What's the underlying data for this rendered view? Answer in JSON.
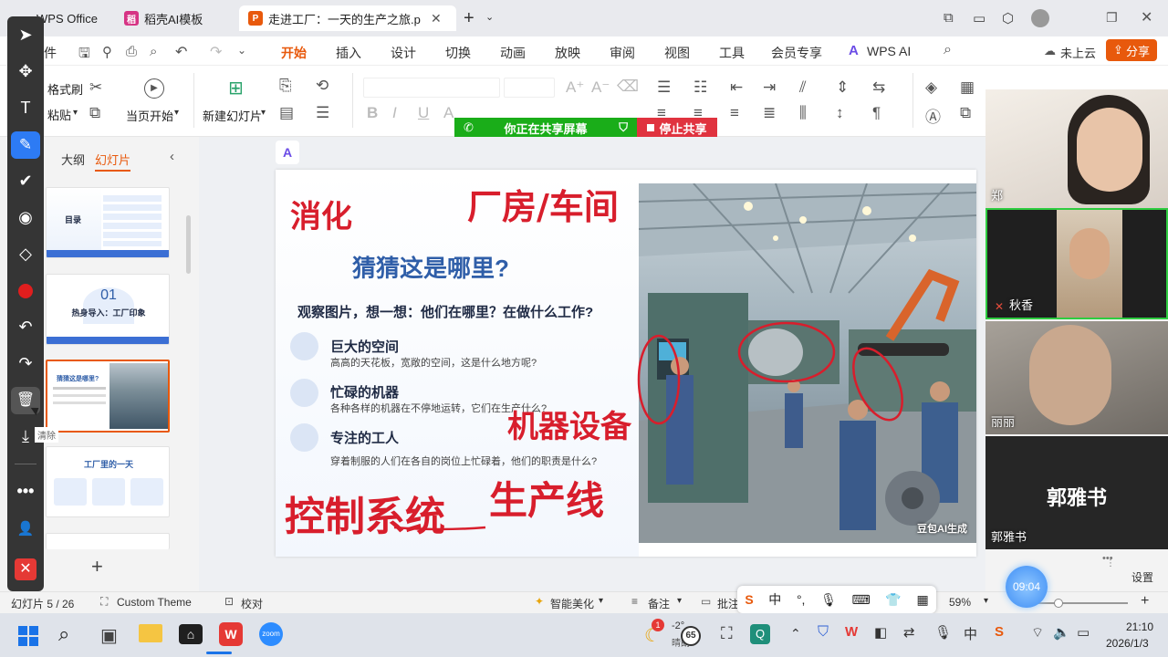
{
  "tabs": [
    {
      "label": "WPS Office"
    },
    {
      "label": "稻壳AI模板"
    },
    {
      "label": "走进工厂：一天的生产之旅.p"
    }
  ],
  "menu": {
    "file": "件",
    "items": [
      "开始",
      "插入",
      "设计",
      "切换",
      "动画",
      "放映",
      "审阅",
      "视图",
      "工具",
      "会员专享"
    ],
    "wps_ai": "WPS AI",
    "cloud": "未上云",
    "share": "分享"
  },
  "ribbon": {
    "format_painter": "格式刷",
    "paste": "粘贴",
    "play_from_current": "当页开始",
    "new_slide": "新建幻灯片"
  },
  "screen_share": {
    "status": "你正在共享屏幕",
    "stop": "停止共享"
  },
  "panel": {
    "outline_tab": "大纲",
    "slides_tab": "幻灯片"
  },
  "thumbnails": [
    {
      "title": "目录",
      "kind": "toc"
    },
    {
      "number": "01",
      "title": "热身导入：工厂印象",
      "kind": "section"
    },
    {
      "title": "猜猜这是哪里?",
      "kind": "image"
    },
    {
      "title": "工厂里的一天",
      "kind": "flow"
    }
  ],
  "slide": {
    "title": "猜猜这是哪里?",
    "question": "观察图片，想一想：他们在哪里？在做什么工作?",
    "bullets": [
      {
        "title": "巨大的空间",
        "desc": "高高的天花板，宽敞的空间，这是什么地方呢?"
      },
      {
        "title": "忙碌的机器",
        "desc": "各种各样的机器在不停地运转，它们在生产什么?"
      },
      {
        "title": "专注的工人",
        "desc": "穿着制服的人们在各自的岗位上忙碌着，他们的职责是什么?"
      }
    ],
    "image_watermark": "豆包AI生成"
  },
  "annotations": [
    "消化",
    "厂房/车间",
    "机器设备",
    "控制系统",
    "生产线"
  ],
  "video": {
    "participants": [
      "郑",
      "秋香",
      "丽丽",
      "郭雅书"
    ],
    "big_name": "郭雅书",
    "settings": "设置"
  },
  "clock": "09:04",
  "toolbar_tooltip": "清除",
  "statusbar": {
    "slide_count": "幻灯片 5 / 26",
    "theme": "Custom Theme",
    "proofread": "校对",
    "beautify": "智能美化",
    "notes": "备注",
    "comments": "批注",
    "zoom": "59%"
  },
  "ime": {
    "lang": "中"
  },
  "taskbar": {
    "notification": "1",
    "weather": "-2°",
    "weather_sub": "晴朗",
    "badge": "65",
    "time": "21:10",
    "date": "2026/1/3",
    "zoom_app": "zoom"
  },
  "colors": {
    "accent": "#e8590c",
    "ink": "#d81e2c",
    "slide_title": "#2f5ea8",
    "share_green": "#1aad19",
    "share_red": "#e0333f"
  }
}
